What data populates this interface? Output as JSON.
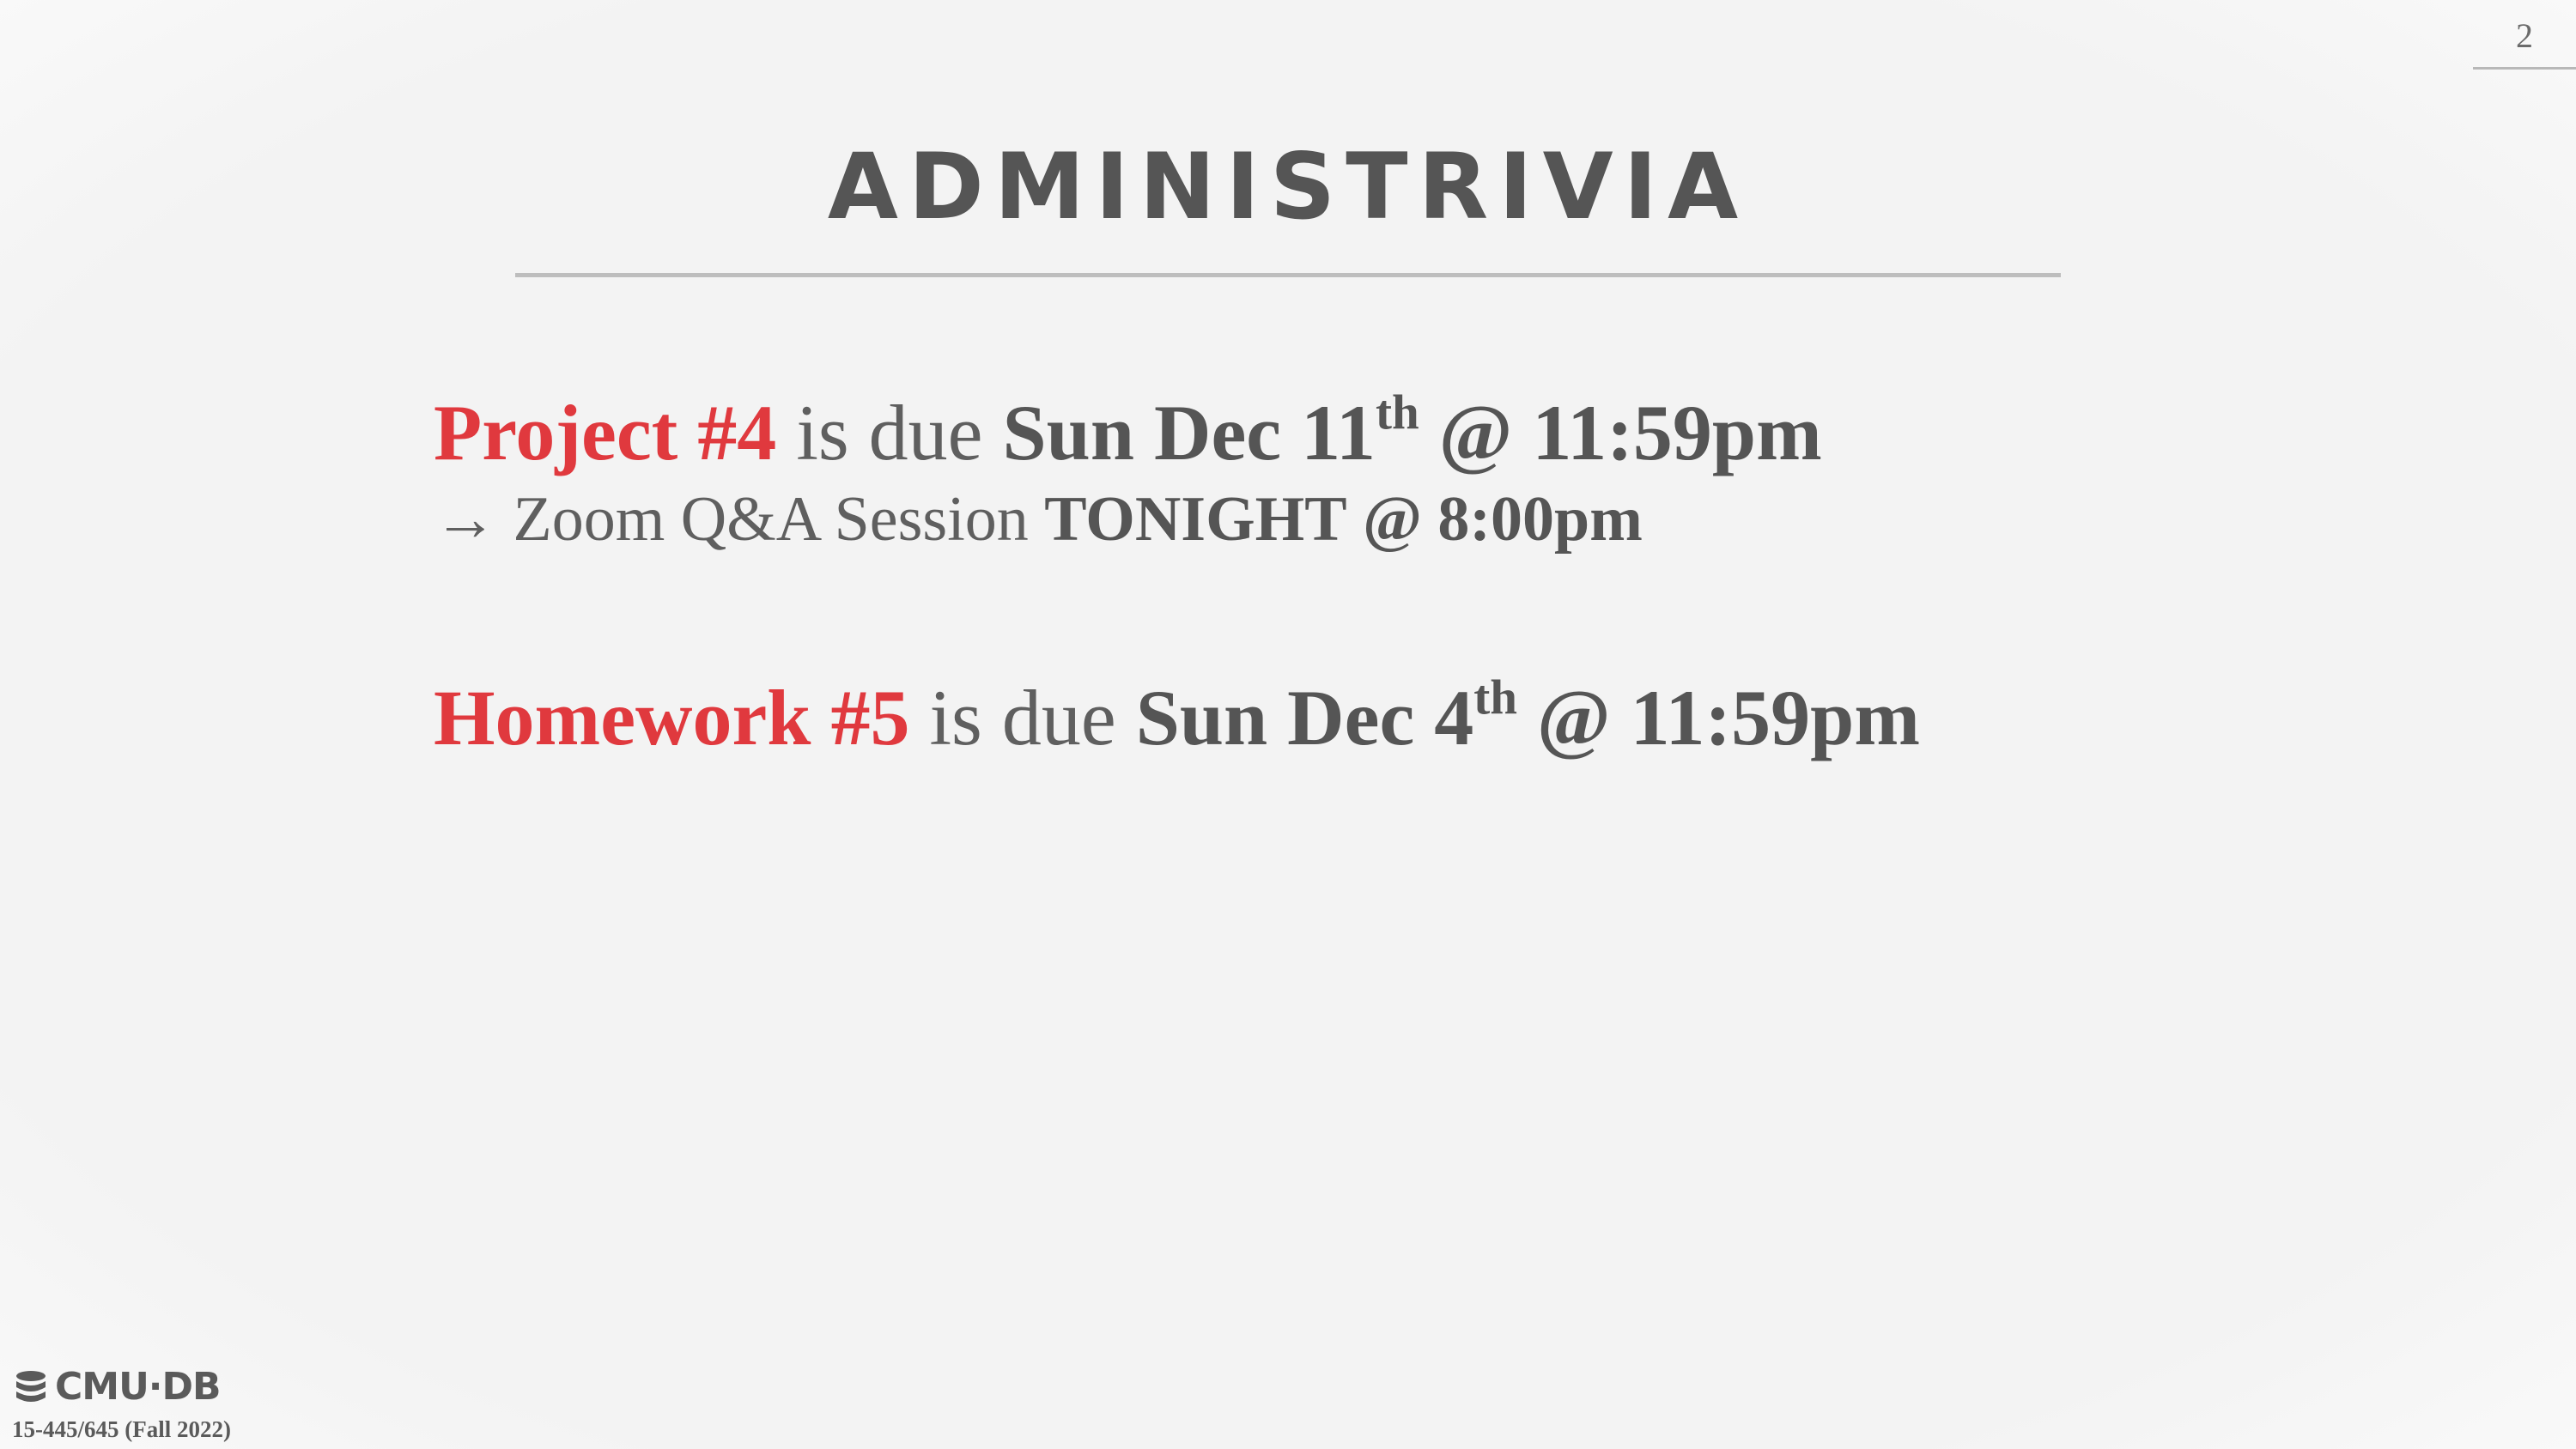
{
  "page_number": "2",
  "title": "ADMINISTRIVIA",
  "items": [
    {
      "highlight": "Project #4",
      "connector": "is due",
      "date_prefix": "Sun Dec 11",
      "date_suffix": "th",
      "time": "@ 11:59pm"
    },
    {
      "highlight": "Homework #5",
      "connector": "is due",
      "date_prefix": "Sun Dec 4",
      "date_suffix": "th",
      "time": "@ 11:59pm"
    }
  ],
  "sub_item": {
    "arrow": "→",
    "text": "Zoom Q&A Session",
    "when_strong": "TONIGHT",
    "when_rest": "@ 8:00pm"
  },
  "footer": {
    "logo_text": "CMU·DB",
    "logo_icon": "database-icon",
    "course": "15-445/645 (Fall 2022)"
  },
  "colors": {
    "accent": "#e0393e",
    "text": "#555555",
    "background": "#f3f3f3"
  }
}
